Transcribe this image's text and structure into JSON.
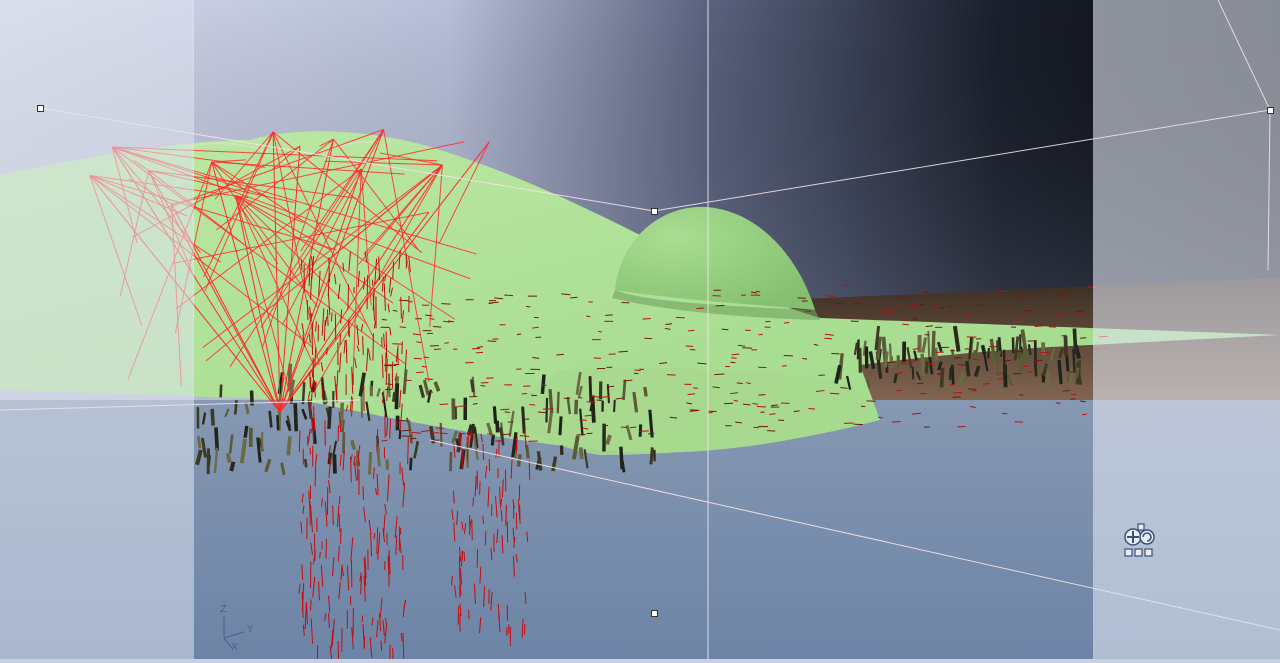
{
  "viewport": {
    "axis_labels": {
      "z": "Z",
      "y": "Y",
      "x": "X"
    }
  },
  "icons": {
    "axis_gizmo": "axis-triad-icon",
    "navigation": "view-navigation-icon",
    "handle": "selection-handle-icon"
  },
  "colors": {
    "terrain": "#b2e29a",
    "wireframe": "#ff2a2a",
    "particles": "#cc0a0a",
    "sky_dark": "#080b12",
    "water": "#7f93ae",
    "panel_overlay": "#dfe4f0"
  }
}
